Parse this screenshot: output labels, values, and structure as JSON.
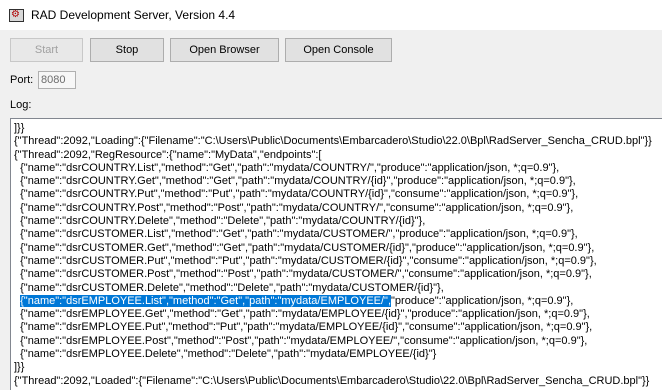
{
  "window": {
    "title": "RAD Development Server, Version 4.4"
  },
  "toolbar": {
    "start_label": "Start",
    "stop_label": "Stop",
    "open_browser_label": "Open Browser",
    "open_console_label": "Open Console"
  },
  "port": {
    "label": "Port:",
    "value": "8080"
  },
  "log": {
    "label": "Log:",
    "lines": [
      "]}}",
      "{\"Thread\":2092,\"Loading\":{\"Filename\":\"C:\\Users\\Public\\Documents\\Embarcadero\\Studio\\22.0\\Bpl\\RadServer_Sencha_CRUD.bpl\"}}",
      "{\"Thread\":2092,\"RegResource\":{\"name\":\"MyData\",\"endpoints\":[",
      "  {\"name\":\"dsrCOUNTRY.List\",\"method\":\"Get\",\"path\":\"mydata/COUNTRY/\",\"produce\":\"application/json, *;q=0.9\"},",
      "  {\"name\":\"dsrCOUNTRY.Get\",\"method\":\"Get\",\"path\":\"mydata/COUNTRY/{id}\",\"produce\":\"application/json, *;q=0.9\"},",
      "  {\"name\":\"dsrCOUNTRY.Put\",\"method\":\"Put\",\"path\":\"mydata/COUNTRY/{id}\",\"consume\":\"application/json, *;q=0.9\"},",
      "  {\"name\":\"dsrCOUNTRY.Post\",\"method\":\"Post\",\"path\":\"mydata/COUNTRY/\",\"consume\":\"application/json, *;q=0.9\"},",
      "  {\"name\":\"dsrCOUNTRY.Delete\",\"method\":\"Delete\",\"path\":\"mydata/COUNTRY/{id}\"},",
      "  {\"name\":\"dsrCUSTOMER.List\",\"method\":\"Get\",\"path\":\"mydata/CUSTOMER/\",\"produce\":\"application/json, *;q=0.9\"},",
      "  {\"name\":\"dsrCUSTOMER.Get\",\"method\":\"Get\",\"path\":\"mydata/CUSTOMER/{id}\",\"produce\":\"application/json, *;q=0.9\"},",
      "  {\"name\":\"dsrCUSTOMER.Put\",\"method\":\"Put\",\"path\":\"mydata/CUSTOMER/{id}\",\"consume\":\"application/json, *;q=0.9\"},",
      "  {\"name\":\"dsrCUSTOMER.Post\",\"method\":\"Post\",\"path\":\"mydata/CUSTOMER/\",\"consume\":\"application/json, *;q=0.9\"},",
      "  {\"name\":\"dsrCUSTOMER.Delete\",\"method\":\"Delete\",\"path\":\"mydata/CUSTOMER/{id}\"},",
      "  {\"name\":\"dsrEMPLOYEE.List\",\"method\":\"Get\",\"path\":\"mydata/EMPLOYEE/\",\"produce\":\"application/json, *;q=0.9\"},",
      "  {\"name\":\"dsrEMPLOYEE.Get\",\"method\":\"Get\",\"path\":\"mydata/EMPLOYEE/{id}\",\"produce\":\"application/json, *;q=0.9\"},",
      "  {\"name\":\"dsrEMPLOYEE.Put\",\"method\":\"Put\",\"path\":\"mydata/EMPLOYEE/{id}\",\"consume\":\"application/json, *;q=0.9\"},",
      "  {\"name\":\"dsrEMPLOYEE.Post\",\"method\":\"Post\",\"path\":\"mydata/EMPLOYEE/\",\"consume\":\"application/json, *;q=0.9\"},",
      "  {\"name\":\"dsrEMPLOYEE.Delete\",\"method\":\"Delete\",\"path\":\"mydata/EMPLOYEE/{id}\"}",
      "]}}",
      "{\"Thread\":2092,\"Loaded\":{\"Filename\":\"C:\\Users\\Public\\Documents\\Embarcadero\\Studio\\22.0\\Bpl\\RadServer_Sencha_CRUD.bpl\"}}"
    ],
    "selected_line": 13,
    "selected_text": "{\"name\":\"dsrEMPLOYEE.List\",\"method\":\"Get\",\"path\":\"mydata/EMPLOYEE/\","
  },
  "colors": {
    "selection": "#0078d7",
    "window_bg": "#f0f0f0",
    "log_bg": "#ffffff"
  }
}
